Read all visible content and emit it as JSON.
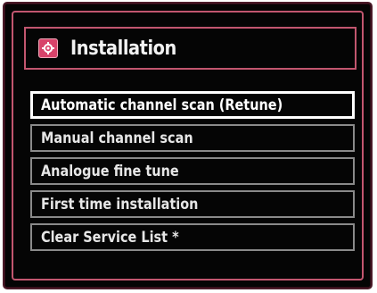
{
  "header": {
    "title": "Installation",
    "icon": "installation-gear-icon",
    "icon_color": "#d8436a"
  },
  "menu": {
    "items": [
      {
        "label": "Automatic channel scan (Retune)",
        "selected": true
      },
      {
        "label": "Manual channel scan",
        "selected": false
      },
      {
        "label": "Analogue fine tune",
        "selected": false
      },
      {
        "label": "First time installation",
        "selected": false
      },
      {
        "label": "Clear Service List *",
        "selected": false
      }
    ]
  },
  "colors": {
    "accent": "#c2566f",
    "background": "#050505",
    "selected_border": "#ffffff",
    "item_border": "#8a8a8a"
  }
}
